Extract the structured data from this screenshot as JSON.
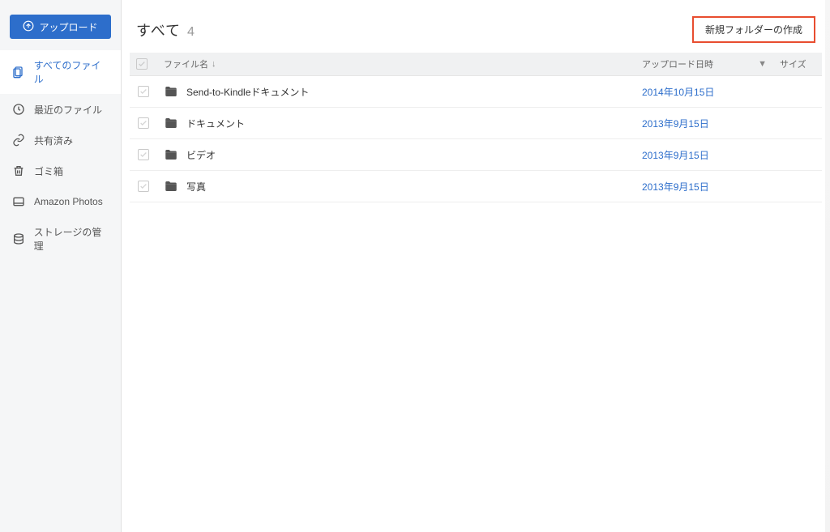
{
  "sidebar": {
    "upload_label": "アップロード",
    "items": [
      {
        "icon": "files-icon",
        "label": "すべてのファイル",
        "active": true
      },
      {
        "icon": "clock-icon",
        "label": "最近のファイル",
        "active": false
      },
      {
        "icon": "link-icon",
        "label": "共有済み",
        "active": false
      },
      {
        "icon": "trash-icon",
        "label": "ゴミ箱",
        "active": false
      },
      {
        "icon": "photos-icon",
        "label": "Amazon Photos",
        "active": false
      },
      {
        "icon": "storage-icon",
        "label": "ストレージの管理",
        "active": false
      }
    ]
  },
  "header": {
    "title": "すべて",
    "count": "4",
    "new_folder_label": "新規フォルダーの作成"
  },
  "columns": {
    "name": "ファイル名",
    "date": "アップロード日時",
    "size": "サイズ"
  },
  "rows": [
    {
      "name": "Send-to-Kindleドキュメント",
      "date": "2014年10月15日",
      "size": ""
    },
    {
      "name": "ドキュメント",
      "date": "2013年9月15日",
      "size": ""
    },
    {
      "name": "ビデオ",
      "date": "2013年9月15日",
      "size": ""
    },
    {
      "name": "写真",
      "date": "2013年9月15日",
      "size": ""
    }
  ],
  "colors": {
    "accent": "#2d6ecb",
    "highlight_border": "#e84d2f"
  }
}
